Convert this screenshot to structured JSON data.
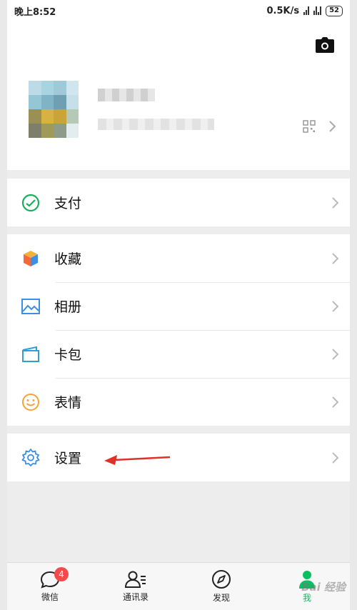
{
  "status_bar": {
    "time": "晚上8:52",
    "network_speed": "0.5K/s",
    "battery": "52"
  },
  "menu": {
    "pay": "支付",
    "favorites": "收藏",
    "album": "相册",
    "cards": "卡包",
    "stickers": "表情",
    "settings": "设置"
  },
  "tabs": [
    {
      "label": "微信",
      "badge": "4",
      "icon": "chat-icon"
    },
    {
      "label": "通讯录",
      "icon": "contacts-icon"
    },
    {
      "label": "发现",
      "icon": "compass-icon"
    },
    {
      "label": "我",
      "icon": "me-icon"
    }
  ],
  "colors": {
    "active_green": "#07c160",
    "badge_red": "#f34b4b",
    "pointer_red": "#e0302a"
  },
  "watermark": "Bai 经验"
}
